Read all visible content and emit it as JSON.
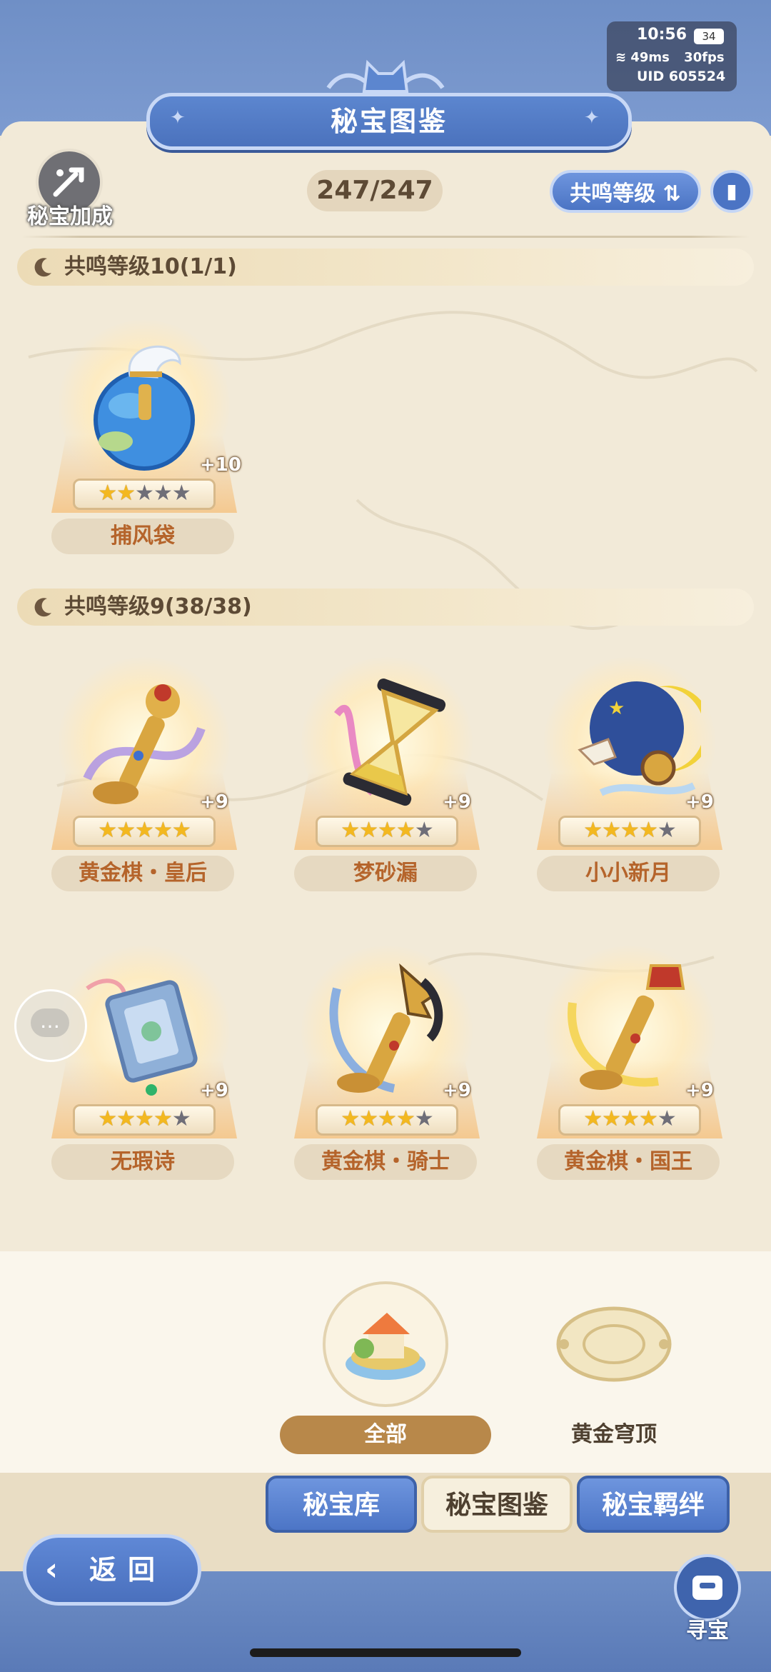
{
  "status": {
    "time": "10:56",
    "battery": "34",
    "ping": "49ms",
    "fps": "30fps",
    "uid": "UID  605524"
  },
  "header": {
    "title": "秘宝图鉴"
  },
  "toolbar": {
    "bonus_label": "秘宝加成",
    "count": "247/247",
    "sort_label": "共鸣等级",
    "sort_icon": "sort-arrows-icon",
    "book_icon": "book-icon"
  },
  "sections": [
    {
      "title": "共鸣等级10(1/1)",
      "items": [
        {
          "name": "捕风袋",
          "plus": "+10",
          "stars": 2,
          "max_stars": 5
        }
      ]
    },
    {
      "title": "共鸣等级9(38/38)",
      "items": [
        {
          "name": "黄金棋・皇后",
          "plus": "+9",
          "stars": 5,
          "max_stars": 5
        },
        {
          "name": "梦砂漏",
          "plus": "+9",
          "stars": 4,
          "max_stars": 5
        },
        {
          "name": "小小新月",
          "plus": "+9",
          "stars": 4,
          "max_stars": 5
        },
        {
          "name": "无瑕诗",
          "plus": "+9",
          "stars": 4,
          "max_stars": 5
        },
        {
          "name": "黄金棋・骑士",
          "plus": "+9",
          "stars": 4,
          "max_stars": 5
        },
        {
          "name": "黄金棋・国王",
          "plus": "+9",
          "stars": 4,
          "max_stars": 5
        }
      ]
    }
  ],
  "categories": {
    "all": "全部",
    "gold": "黄金穹顶"
  },
  "tabs": {
    "vault": "秘宝库",
    "codex": "秘宝图鉴",
    "bond": "秘宝羁绊"
  },
  "nav": {
    "back": "返回",
    "treasure": "寻宝"
  },
  "colors": {
    "accent_blue": "#4b74c4",
    "panel": "#f2ead8",
    "name_text": "#b5642b",
    "star": "#f3b820"
  }
}
